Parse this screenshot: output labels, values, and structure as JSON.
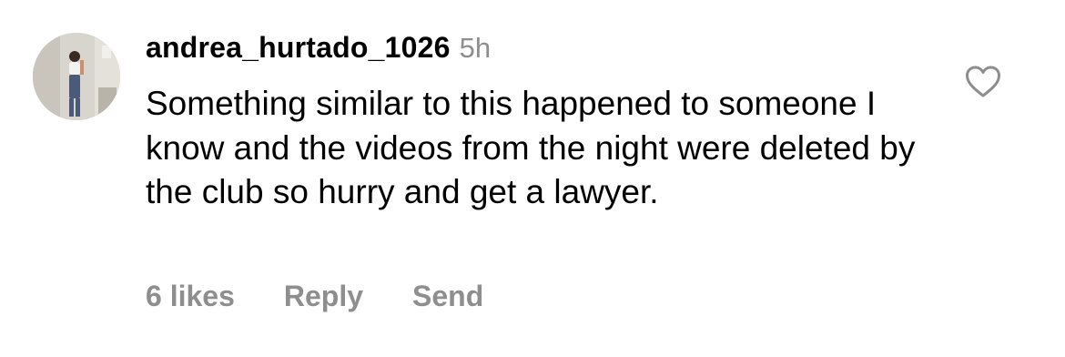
{
  "comment": {
    "username": "andrea_hurtado_1026",
    "timestamp": "5h",
    "text": "Something similar to this happened to someone I know and the videos from the night were deleted by the club so hurry and get a lawyer.",
    "avatar_icon": "avatar-photo",
    "like_icon": "heart-outline-icon"
  },
  "actions": {
    "likes_label": "6 likes",
    "reply_label": "Reply",
    "send_label": "Send"
  },
  "colors": {
    "text": "#000000",
    "secondary": "#8e8e8e",
    "background": "#ffffff"
  }
}
